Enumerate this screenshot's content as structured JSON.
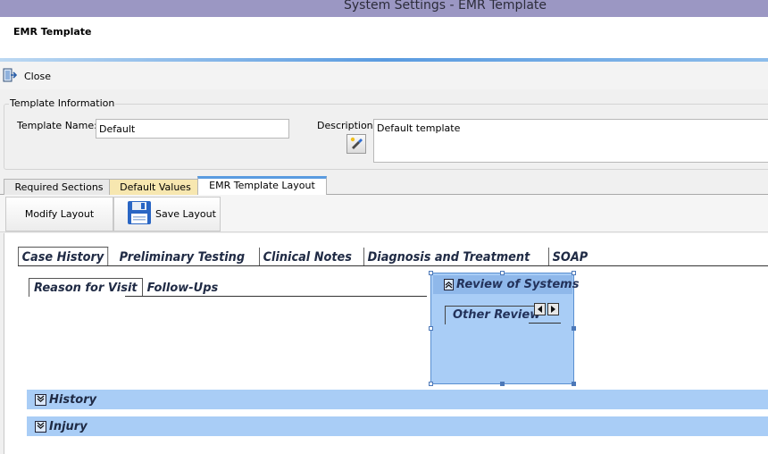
{
  "window": {
    "title": "System Settings - EMR Template"
  },
  "header": {
    "title": "EMR Template"
  },
  "toolbar": {
    "close_label": "Close"
  },
  "template_info": {
    "legend": "Template Information",
    "name_label": "Template Name:",
    "name_value": "Default",
    "description_label": "Description:",
    "description_value": "Default template"
  },
  "tabs": [
    {
      "label": "Required Sections"
    },
    {
      "label": "Default Values"
    },
    {
      "label": "EMR Template Layout"
    }
  ],
  "layout_buttons": {
    "modify_label": "Modify Layout",
    "save_label": "Save Layout"
  },
  "main_tabs": [
    {
      "label": "Case History"
    },
    {
      "label": "Preliminary Testing"
    },
    {
      "label": "Clinical Notes"
    },
    {
      "label": "Diagnosis and Treatment"
    },
    {
      "label": "SOAP"
    }
  ],
  "sub_tabs": [
    {
      "label": "Reason for Visit"
    },
    {
      "label": "Follow-Ups"
    }
  ],
  "review_panel": {
    "title": "Review of Systems",
    "subtab": "Other Review"
  },
  "sections": [
    {
      "title": "History"
    },
    {
      "title": "Injury"
    }
  ],
  "colors": {
    "titlebar": "#9b97c3",
    "accent": "#5a9be0",
    "section_fill": "#a9cdf6",
    "default_values_tab": "#f7e7b0"
  }
}
